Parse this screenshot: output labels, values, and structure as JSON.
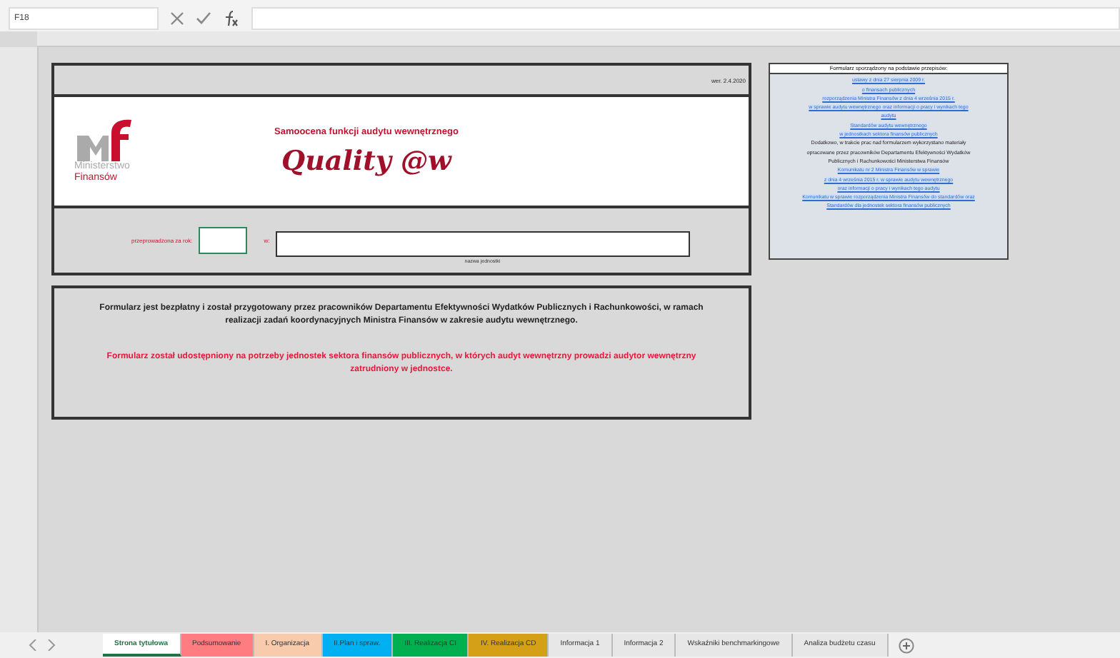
{
  "formula_bar": {
    "name_box": "F18"
  },
  "form": {
    "version": "wer. 2.4.2020",
    "logo_text": [
      "Ministerstwo",
      "Finansów"
    ],
    "subtitle": "Samoocena funkcji audytu wewnętrznego",
    "title": "Quality @w",
    "year_label": "przeprowadzona za rok:",
    "unit_prefix": "w:",
    "unit_caption": "nazwa jednostki"
  },
  "notes": [
    {
      "kind": "info",
      "text": "Formularz jest bezpłatny i został przygotowany przez pracowników Departamentu Efektywności Wydatków Publicznych i Rachunkowości, w ramach realizacji zadań koordynacyjnych Ministra Finansów w zakresie audytu wewnętrznego."
    },
    {
      "kind": "warning",
      "text": "Formularz został udostępniony na potrzeby jednostek sektora finansów publicznych, w których audyt wewnętrzny prowadzi audytor wewnętrzny zatrudniony w jednostce."
    }
  ],
  "sources": {
    "heading": "Formularz sporządzony na podstawie przepisów:",
    "lines": [
      {
        "kind": "link",
        "text": "ustawy z dnia 27 sierpnia 2009 r."
      },
      {
        "kind": "link",
        "text": "o finansach publicznych"
      },
      {
        "kind": "link",
        "text": "rozporządzenia Ministra Finansów z dnia 4 września 2015 r."
      },
      {
        "kind": "link",
        "text": "w sprawie audytu wewnętrznego oraz informacji o pracy i wynikach tego"
      },
      {
        "kind": "link",
        "text": "audytu"
      },
      {
        "kind": "link",
        "text": "Standardów audytu wewnętrznego"
      },
      {
        "kind": "link",
        "text": "w jednostkach sektora finansów publicznych"
      },
      {
        "kind": "text",
        "text": "Dodatkowo, w trakcie prac nad formularzem wykorzystano materiały"
      },
      {
        "kind": "text",
        "text": "opracowane przez pracowników Departamentu Efektywności Wydatków"
      },
      {
        "kind": "text",
        "text": "Publicznych i Rachunkowości Ministerstwa Finansów"
      },
      {
        "kind": "link",
        "text": "Komunikatu nr 2 Ministra Finansów w sprawie"
      },
      {
        "kind": "link",
        "text": "z dnia 4 września 2015 r. w sprawie audytu wewnętrznego"
      },
      {
        "kind": "link",
        "text": "oraz informacji o pracy i wynikach tego audytu"
      },
      {
        "kind": "link",
        "text": "Komunikatu w sprawie rozporządzenia Ministra Finansów do standardów oraz"
      },
      {
        "kind": "link",
        "text": "Standardów dla jednostek sektora finansów publicznych"
      }
    ]
  },
  "sheet_tabs": [
    {
      "label": "Strona tytułowa",
      "selected": true,
      "color": "#ffffff"
    },
    {
      "label": "Podsumowanie",
      "selected": false,
      "color": "#ff7c80"
    },
    {
      "label": "I. Organizacja",
      "selected": false,
      "color": "#f8cbad"
    },
    {
      "label": "II.Plan i spraw.",
      "selected": false,
      "color": "#00b0f0"
    },
    {
      "label": "III. Realizacja CI",
      "selected": false,
      "color": "#00b050"
    },
    {
      "label": "IV. Realizacja CD",
      "selected": false,
      "color": "#d4a017"
    },
    {
      "label": "Informacja 1",
      "selected": false,
      "color": "#e7e7e7"
    },
    {
      "label": "Informacja 2",
      "selected": false,
      "color": "#e7e7e7"
    },
    {
      "label": "Wskaźniki benchmarkingowe",
      "selected": false,
      "color": "#e7e7e7"
    },
    {
      "label": "Analiza budżetu czasu",
      "selected": false,
      "color": "#e7e7e7"
    }
  ]
}
